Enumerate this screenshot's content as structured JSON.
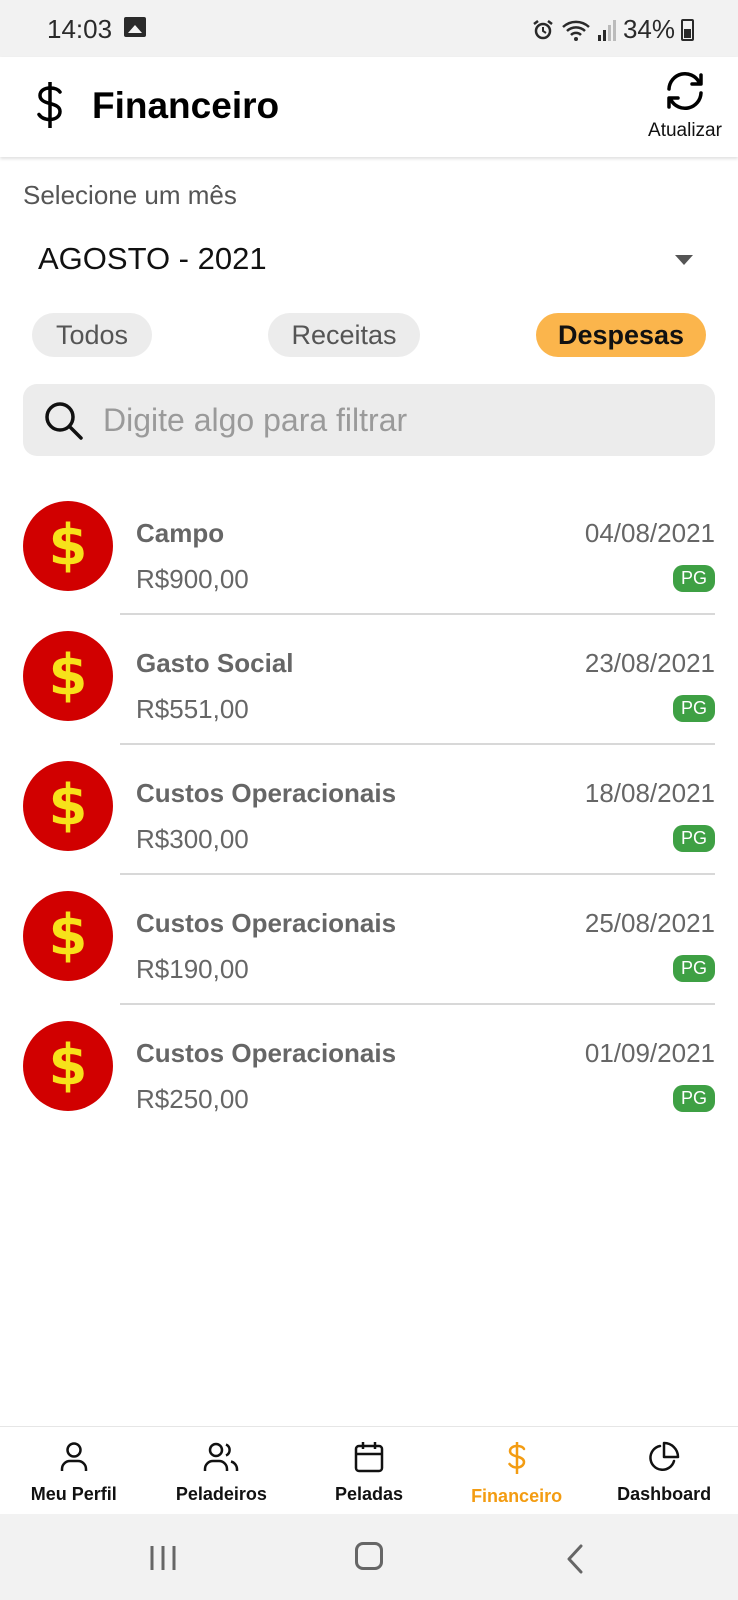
{
  "status_bar": {
    "time": "14:03",
    "battery": "34%",
    "icons": [
      "image-icon",
      "alarm-icon",
      "wifi-icon",
      "signal-icon",
      "battery-icon"
    ]
  },
  "header": {
    "title": "Financeiro",
    "refresh_label": "Atualizar",
    "icons": [
      "dollar-icon",
      "refresh-icon"
    ]
  },
  "month": {
    "label": "Selecione um mês",
    "value": "AGOSTO - 2021"
  },
  "filters": {
    "todos": "Todos",
    "receitas": "Receitas",
    "despesas": "Despesas",
    "active": "despesas",
    "active_color": "#fbb54c"
  },
  "search": {
    "placeholder": "Digite algo para filtrar",
    "value": ""
  },
  "transactions": [
    {
      "title": "Campo",
      "amount": "R$900,00",
      "date": "04/08/2021",
      "status": "PG"
    },
    {
      "title": "Gasto Social",
      "amount": "R$551,00",
      "date": "23/08/2021",
      "status": "PG"
    },
    {
      "title": "Custos Operacionais",
      "amount": "R$300,00",
      "date": "18/08/2021",
      "status": "PG"
    },
    {
      "title": "Custos Operacionais",
      "amount": "R$190,00",
      "date": "25/08/2021",
      "status": "PG"
    },
    {
      "title": "Custos Operacionais",
      "amount": "R$250,00",
      "date": "01/09/2021",
      "status": "PG"
    }
  ],
  "avatar": {
    "symbol": "$",
    "bg_color": "#d10000",
    "fg_color": "#f7e21a"
  },
  "badge_color": "#3ea044",
  "bottom_nav": {
    "items": [
      {
        "label": "Meu Perfil",
        "icon": "user-icon"
      },
      {
        "label": "Peladeiros",
        "icon": "users-icon"
      },
      {
        "label": "Peladas",
        "icon": "calendar-icon"
      },
      {
        "label": "Financeiro",
        "icon": "dollar-icon"
      },
      {
        "label": "Dashboard",
        "icon": "pie-chart-icon"
      }
    ],
    "active_index": 3,
    "active_color": "#f39c12"
  }
}
